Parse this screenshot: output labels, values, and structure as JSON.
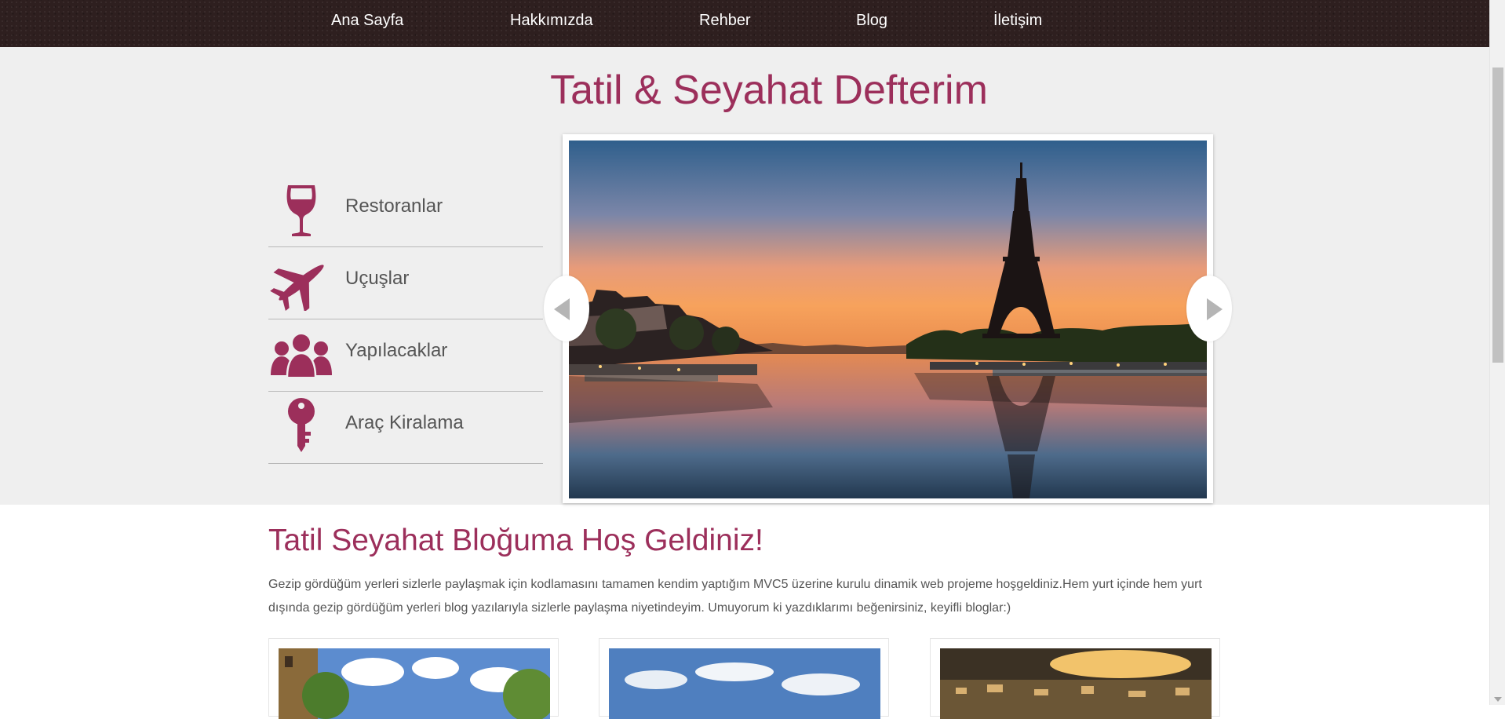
{
  "nav": {
    "items": [
      {
        "label": "Ana Sayfa"
      },
      {
        "label": "Hakkımızda"
      },
      {
        "label": "Rehber"
      },
      {
        "label": "Blog"
      },
      {
        "label": "İletişim"
      }
    ]
  },
  "hero": {
    "title": "Tatil & Seyahat Defterim",
    "menu": [
      {
        "label": "Restoranlar",
        "icon": "wine-glass-icon"
      },
      {
        "label": "Uçuşlar",
        "icon": "airplane-icon"
      },
      {
        "label": "Yapılacaklar",
        "icon": "people-icon"
      },
      {
        "label": "Araç Kiralama",
        "icon": "key-icon"
      }
    ],
    "slider": {
      "image": "paris-eiffel-tower-sunset-photo",
      "prev_icon": "chevron-left-icon",
      "next_icon": "chevron-right-icon"
    }
  },
  "welcome": {
    "title": "Tatil Seyahat Bloğuma Hoş Geldiniz!",
    "text": "Gezip gördüğüm yerleri sizlerle paylaşmak için kodlamasını tamamen kendim yaptığım MVC5 üzerine kurulu dinamik web projeme hoşgeldiniz.Hem yurt içinde hem yurt dışında gezip gördüğüm yerleri blog yazılarıyla sizlerle paylaşma niyetindeyim. Umuyorum ki yazdıklarımı beğenirsiniz, keyifli bloglar:)"
  },
  "cards": [
    {
      "image": "street-trees-photo"
    },
    {
      "image": "sky-clouds-photo"
    },
    {
      "image": "city-sunset-photo"
    }
  ],
  "colors": {
    "accent": "#9c2f5b",
    "nav_bg": "#2e1f1f",
    "hero_bg": "#efefef",
    "text": "#555555"
  }
}
